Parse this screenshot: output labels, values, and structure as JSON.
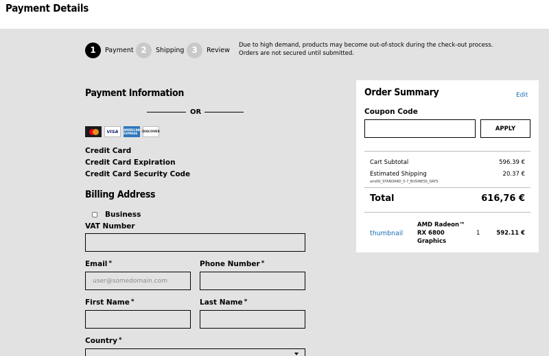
{
  "page": {
    "title": "Payment Details"
  },
  "steps": [
    {
      "number": "1",
      "label": "Payment"
    },
    {
      "number": "2",
      "label": "Shipping"
    },
    {
      "number": "3",
      "label": "Review"
    }
  ],
  "notice": "Due to high demand, products may become out-of-stock during the check-out process. Orders are not secured until submitted.",
  "payment": {
    "heading": "Payment Information",
    "or_text": "OR",
    "cards": [
      "mastercard-icon",
      "visa-icon",
      "amex-icon",
      "discover-icon"
    ],
    "card_labels": {
      "visa": "VISA",
      "amex": "AMERICAN EXPRESS",
      "discover": "DISCOVER"
    },
    "fields": [
      "Credit Card",
      "Credit Card Expiration",
      "Credit Card Security Code"
    ]
  },
  "billing": {
    "heading": "Billing Address",
    "business_label": "Business",
    "vat_label": "VAT Number",
    "email_label": "Email",
    "email_placeholder": "user@somedomain.com",
    "phone_label": "Phone Number",
    "first_name_label": "First Name",
    "last_name_label": "Last Name",
    "country_label": "Country",
    "required_mark": "*"
  },
  "summary": {
    "heading": "Order Summary",
    "edit_label": "Edit",
    "coupon_label": "Coupon Code",
    "apply_label": "APPLY",
    "subtotal_label": "Cart Subtotal",
    "subtotal_value": "596.39 €",
    "shipping_label": "Estimated Shipping",
    "shipping_value": "20.37 €",
    "shipping_method": "amdSI_STANDARD_5-7_BUSINESS_DAYS",
    "total_label": "Total",
    "total_value": "616,76 €",
    "item": {
      "thumbnail_label": "thumbnail",
      "name": "AMD Radeon™ RX 6800 Graphics",
      "qty": "1",
      "price": "592.11 €"
    }
  }
}
